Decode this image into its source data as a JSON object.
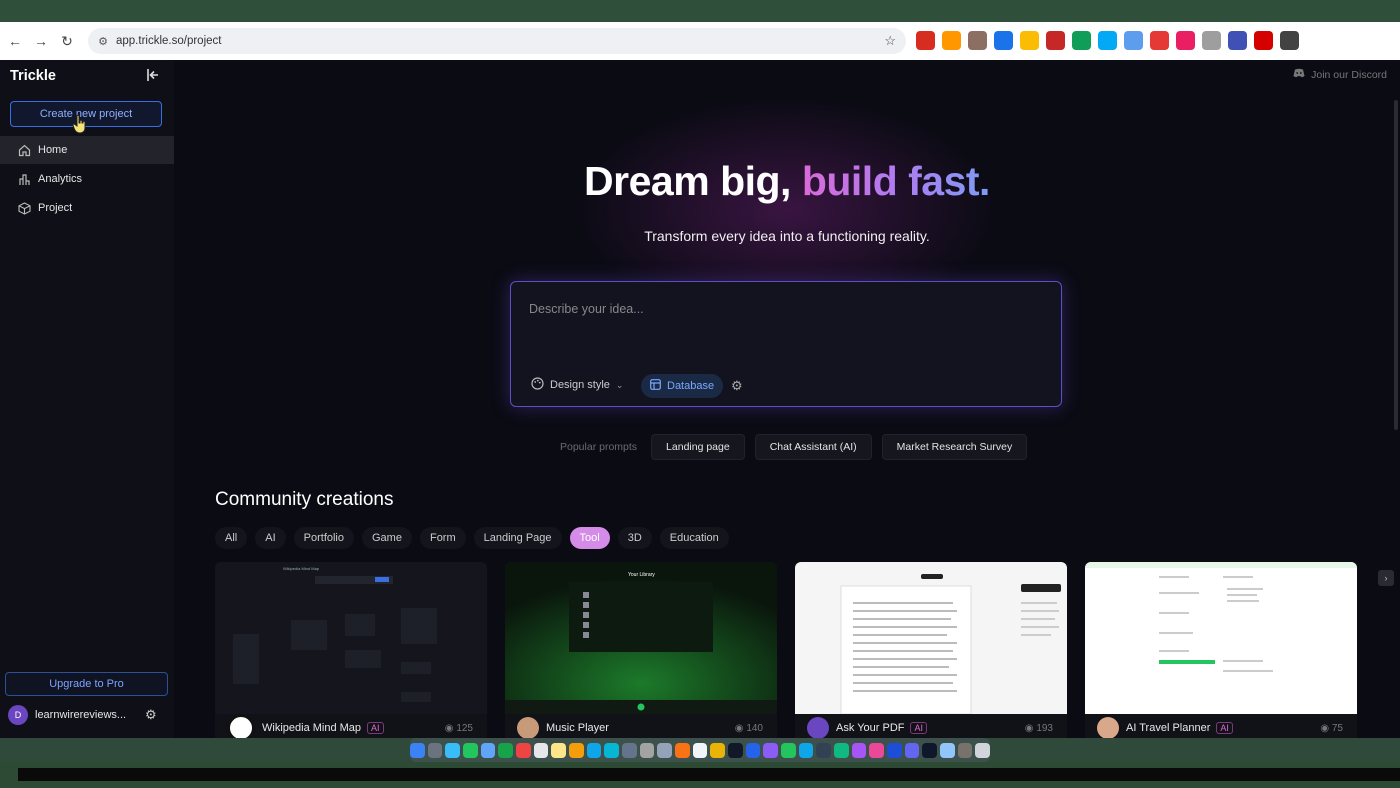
{
  "browser": {
    "url": "app.trickle.so/project",
    "nav_icons": [
      "back-arrow-icon",
      "forward-arrow-icon",
      "reload-icon"
    ],
    "extension_colors": [
      "#d62d20",
      "#ff9800",
      "#8d6e63",
      "#1a73e8",
      "#fbbc04",
      "#c62828",
      "#0f9d58",
      "#03a9f4",
      "#5c9ded",
      "#e53935",
      "#e91e63",
      "#9e9e9e",
      "#3f51b5",
      "#d50000",
      "#424242"
    ]
  },
  "sidebar": {
    "brand": "Trickle",
    "create_label": "Create new project",
    "items": [
      {
        "label": "Home",
        "icon": "home-icon",
        "active": true
      },
      {
        "label": "Analytics",
        "icon": "analytics-icon",
        "active": false
      },
      {
        "label": "Project",
        "icon": "cube-icon",
        "active": false
      }
    ],
    "upgrade_label": "Upgrade to Pro",
    "user": {
      "initial": "D",
      "name": "learnwirereviews..."
    }
  },
  "header": {
    "discord_label": "Join our Discord"
  },
  "hero": {
    "title_plain": "Dream big, ",
    "title_gradient": "build fast.",
    "subtitle": "Transform every idea into a functioning reality."
  },
  "idea_box": {
    "placeholder": "Describe your idea...",
    "design_style_label": "Design style",
    "database_label": "Database"
  },
  "popular_prompts": {
    "label": "Popular prompts",
    "items": [
      "Landing page",
      "Chat Assistant (AI)",
      "Market Research Survey"
    ]
  },
  "community": {
    "title": "Community creations",
    "filters": [
      "All",
      "AI",
      "Portfolio",
      "Game",
      "Form",
      "Landing Page",
      "Tool",
      "3D",
      "Education"
    ],
    "active_filter": "Tool",
    "cards": [
      {
        "name": "Wikipedia Mind Map",
        "badge": "AI",
        "views": "125"
      },
      {
        "name": "Music Player",
        "badge": "",
        "views": "140"
      },
      {
        "name": "Ask Your PDF",
        "badge": "AI",
        "views": "193"
      },
      {
        "name": "AI Travel Planner",
        "badge": "AI",
        "views": "75"
      }
    ]
  },
  "dock": {
    "app_colors": [
      "#3b82f6",
      "#6b7280",
      "#38bdf8",
      "#22c55e",
      "#60a5fa",
      "#16a34a",
      "#ef4444",
      "#e5e7eb",
      "#fde68a",
      "#f59e0b",
      "#0ea5e9",
      "#06b6d4",
      "#64748b",
      "#a3a3a3",
      "#94a3b8",
      "#f97316",
      "#f1f5f9",
      "#eab308",
      "#111827",
      "#2563eb",
      "#8b5cf6",
      "#22c55e",
      "#0ea5e9",
      "#334155",
      "#10b981",
      "#a855f7",
      "#ec4899",
      "#1d4ed8",
      "#6366f1",
      "#0f172a",
      "#93c5fd",
      "#78716c",
      "#d1d5db"
    ]
  }
}
